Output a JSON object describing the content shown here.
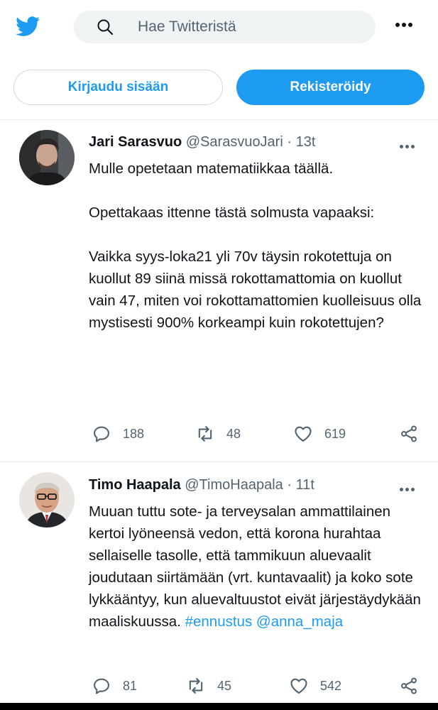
{
  "header": {
    "search_placeholder": "Hae Twitteristä",
    "login_label": "Kirjaudu sisään",
    "signup_label": "Rekisteröidy"
  },
  "colors": {
    "accent": "#1d9bf0",
    "muted": "#536471",
    "text": "#0f1419"
  },
  "tweets": [
    {
      "name": "Jari Sarasvuo",
      "handle": "@SarasvuoJari",
      "separator": "·",
      "time": "13t",
      "paragraphs": [
        "Mulle opetetaan matematiikkaa täällä.",
        "Opettakaas ittenne tästä solmusta vapaaksi:",
        "Vaikka syys-loka21 yli 70v täysin rokotettuja on kuollut 89 siinä missä rokottamattomia on kuollut vain 47, miten voi rokottamattomien kuolleisuus olla mystisesti 900% korkeampi kuin rokotettujen?"
      ],
      "replies": "188",
      "retweets": "48",
      "likes": "619"
    },
    {
      "name": "Timo Haapala",
      "handle": "@TimoHaapala",
      "separator": "·",
      "time": "11t",
      "text": "Muuan tuttu sote- ja terveysalan ammattilainen kertoi lyöneensä vedon, että korona hurahtaa sellaiselle tasolle, että tammikuun aluevaalit joudutaan siirtämään (vrt. kuntavaalit) ja koko sote lykkääntyy, kun aluevaltuustot eivät järjestäydykään maaliskuussa.",
      "hashtag": "#ennustus",
      "mention": "@anna_maja",
      "replies": "81",
      "retweets": "45",
      "likes": "542"
    }
  ]
}
